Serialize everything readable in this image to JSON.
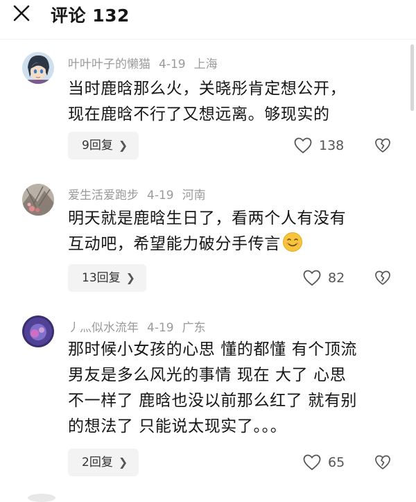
{
  "header": {
    "title": "评论 132"
  },
  "comments": [
    {
      "username": "叶叶叶子的懒猫",
      "date": "4-19",
      "location": "上海",
      "lines": [
        "当时鹿晗那么火，关晓彤肯定想公开，",
        "现在鹿晗不行了又想远离。够现实的"
      ],
      "reply_label": "9回复",
      "likes": "138"
    },
    {
      "username": "爱生活爱跑步",
      "date": "4-19",
      "location": "河南",
      "lines": [
        "明天就是鹿晗生日了，看两个人有没有",
        "互动吧，希望能力破分手传言"
      ],
      "reply_label": "13回复",
      "likes": "82"
    },
    {
      "username": "丿灬似水流年",
      "date": "4-19",
      "location": "广东",
      "lines": [
        "那时候小女孩的心思 懂的都懂 有个顶流",
        "男友是多么风光的事情 现在 大了 心思",
        "不一样了 鹿晗也没以前那么红了 就有别",
        "的想法了 只能说太现实了。。。"
      ],
      "reply_label": "2回复",
      "likes": "65"
    }
  ],
  "icons": {
    "close": "close-icon",
    "heart": "heart-icon",
    "dislike": "broken-heart-icon",
    "chevron": "chevron-right-icon",
    "emoji": "smiling-face-emoji"
  },
  "colors": {
    "text": "#161616",
    "meta": "#9a9a9a",
    "button_bg": "#f3f3f3"
  }
}
